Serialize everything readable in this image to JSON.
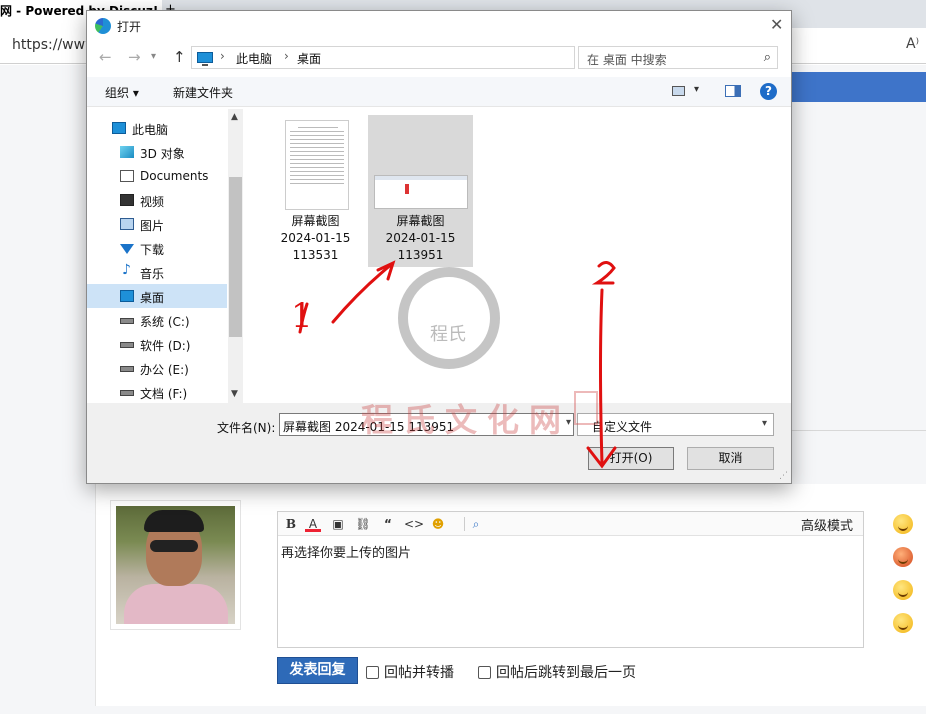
{
  "browser": {
    "tab_title": "网 - Powered by Discuz!",
    "tab_close": "+",
    "url": "https://www",
    "read_aloud": "A⁾"
  },
  "dialog": {
    "title": "打开",
    "close": "✕",
    "nav": {
      "back": "←",
      "forward": "→",
      "up": "↑"
    },
    "breadcrumb": [
      "此电脑",
      "桌面"
    ],
    "search_placeholder": "在 桌面 中搜索",
    "toolbar": {
      "organize": "组织 ▾",
      "new_folder": "新建文件夹",
      "help": "?"
    },
    "tree": [
      {
        "label": "此电脑",
        "icon": "computer-icon"
      },
      {
        "label": "3D 对象",
        "icon": "3d-objects-icon"
      },
      {
        "label": "Documents",
        "icon": "document-icon"
      },
      {
        "label": "视频",
        "icon": "video-icon"
      },
      {
        "label": "图片",
        "icon": "picture-icon"
      },
      {
        "label": "下载",
        "icon": "download-icon"
      },
      {
        "label": "音乐",
        "icon": "music-icon"
      },
      {
        "label": "桌面",
        "icon": "desktop-icon",
        "selected": true
      },
      {
        "label": "系统 (C:)",
        "icon": "drive-icon"
      },
      {
        "label": "软件 (D:)",
        "icon": "drive-icon"
      },
      {
        "label": "办公 (E:)",
        "icon": "drive-icon"
      },
      {
        "label": "文档 (F:)",
        "icon": "drive-icon"
      }
    ],
    "files": [
      {
        "name_line1": "屏幕截图",
        "name_line2": "2024-01-15",
        "name_line3": "113531",
        "kind": "document-thumbnail",
        "selected": false
      },
      {
        "name_line1": "屏幕截图",
        "name_line2": "2024-01-15",
        "name_line3": "113951",
        "kind": "screenshot-thumbnail",
        "selected": true
      }
    ],
    "filename_label": "文件名(N):",
    "filename_value": "屏幕截图 2024-01-15 113951",
    "filetype_value": "自定义文件",
    "open_button": "打开(O)",
    "cancel_button": "取消"
  },
  "reply": {
    "toolbar": {
      "bold": "B",
      "color": "A",
      "image": "▣",
      "link": "⛓",
      "quote": "“",
      "code": "<>",
      "emoji": "☻",
      "attach": "⌕",
      "advanced_mode": "高级模式"
    },
    "editor_text": "再选择你要上传的图片",
    "submit": "发表回复",
    "option_repost": "回帖并转播",
    "option_jump": "回帖后跳转到最后一页"
  },
  "watermark": {
    "site_name": "程氏文化网",
    "seal_text": "程氏"
  },
  "annotations": {
    "step1": "1",
    "step2": "2"
  },
  "colors": {
    "accent_blue": "#3e74c9",
    "submit_blue": "#2e6ab8",
    "annotation_red": "#e01010",
    "selection": "#cde3f7"
  }
}
